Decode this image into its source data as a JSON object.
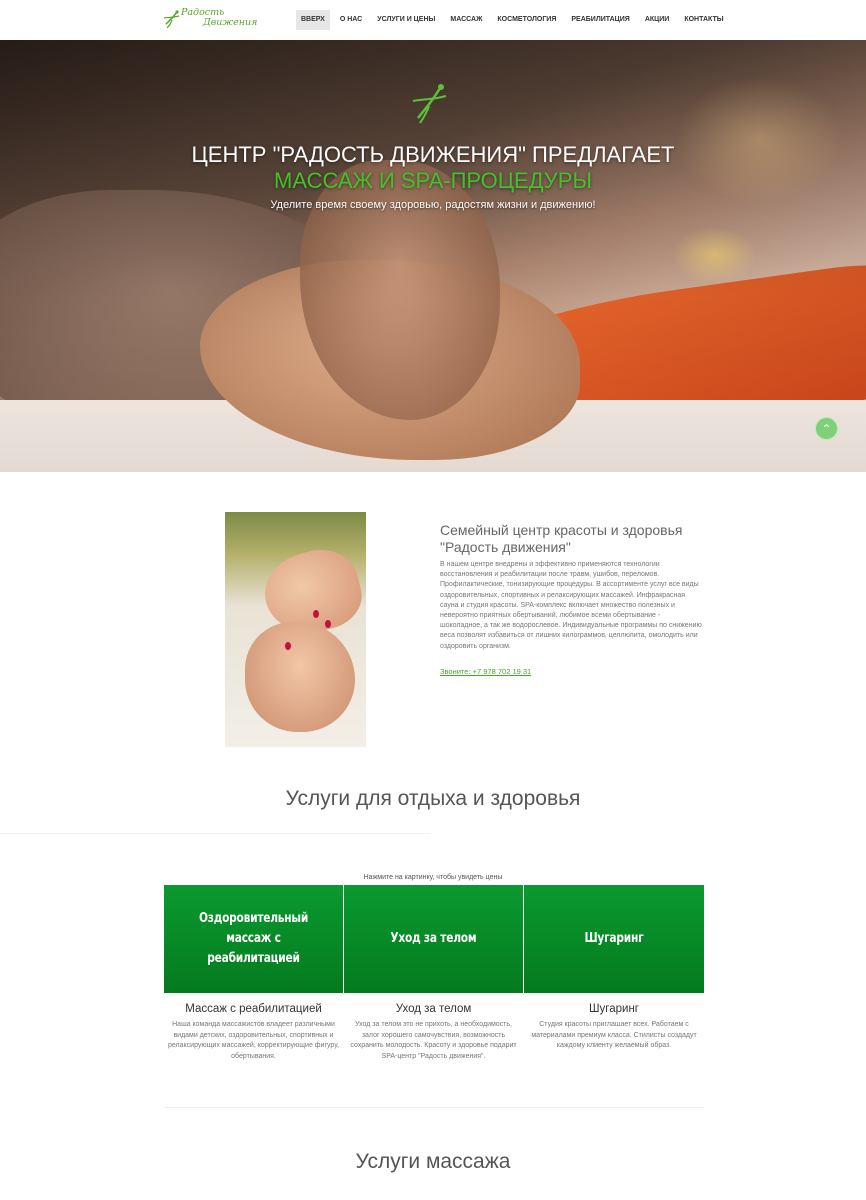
{
  "header": {
    "logo_line1": "Радость",
    "logo_line2": "Движения",
    "nav": [
      "ВВЕРХ",
      "О НАС",
      "УСЛУГИ И ЦЕНЫ",
      "МАССАЖ",
      "КОСМЕТОЛОГИЯ",
      "РЕАБИЛИТАЦИЯ",
      "АКЦИИ",
      "КОНТАКТЫ"
    ],
    "active_nav": "ВВЕРХ"
  },
  "hero": {
    "title_line1": "ЦЕНТР \"РАДОСТЬ ДВИЖЕНИЯ\" ПРЕДЛАГАЕТ",
    "title_line2": "МАССАЖ И SPA-ПРОЦЕДУРЫ",
    "subtitle": "Уделите время своему здоровью, радостям жизни и движению!",
    "scroll_icon": "chevron-up-icon"
  },
  "about": {
    "title": "Семейный центр красоты и здоровья \"Радость движения\"",
    "text": "В нашем центре внедрены и эффективно применяются технологии восстановления и реабилитации после травм, ушибов, переломов. Профилактические, тонизирующие процедуры. В ассортименте услуг все виды оздоровительных, спортивных и релаксирующих массажей. Инфракрасная сауна и студия красоты. SPA-комплекс включает множество полезных и невероятно приятных обертываний, любимое всеми обертывание - шоколадное, а так же водорослевое. Индивидуальные программы по снижению веса позволят избавиться от лишних килограммов, целлюлита, омолодить или оздоровить организм.",
    "phone": "Звоните: +7 978 702 19 31"
  },
  "services": {
    "title": "Услуги для отдыха и здоровья",
    "hint": "Нажмите на картинку, чтобы увидеть цены",
    "cards": [
      {
        "image_text": "Оздоровительный массаж с реабилитацией",
        "name": "Массаж с реабилитацией",
        "desc": "Наша команда массажистов владеет различными видами детских, оздоровительных, спортивных и релаксирующих массажей, корректирующие фигуру, обертывания."
      },
      {
        "image_text": "Уход за телом",
        "name": "Уход за телом",
        "desc": "Уход за телом это не прихоть, а необходимость, залог хорошего самочувствия, возможность сохранить молодость. Красоту и здоровье подарит SPA-центр \"Радость движения\"."
      },
      {
        "image_text": "Шугаринг",
        "name": "Шугаринг",
        "desc": "Студия красоты приглашает всех. Работаем с материалами премиум класса. Стилисты создадут каждому клиенту желаемый образ."
      }
    ]
  },
  "massage": {
    "title": "Услуги массажа"
  },
  "colors": {
    "accent_green": "#45c02a",
    "card_green": "#06892a"
  }
}
